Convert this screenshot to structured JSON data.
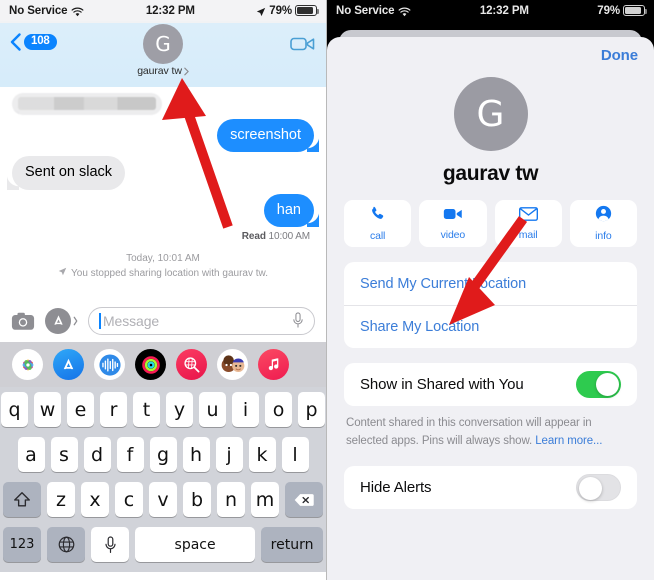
{
  "left_pane": {
    "status_bar": {
      "carrier": "No Service",
      "wifi_icon": "wifi-icon",
      "time": "12:32 PM",
      "location_icon": "location-arrow-icon",
      "battery": "79%"
    },
    "header": {
      "back_icon": "chevron-left-icon",
      "unread_badge": "108",
      "avatar_initial": "G",
      "contact_name": "gaurav tw",
      "disclosure_icon": "chevron-right-icon",
      "facetime_icon": "video-camera-icon"
    },
    "thread": {
      "messages": [
        {
          "side": "in",
          "text": "",
          "redacted": true
        },
        {
          "side": "out",
          "text": "screenshot",
          "redacted": false
        },
        {
          "side": "in",
          "text": "Sent on slack",
          "redacted": false
        },
        {
          "side": "out",
          "text": "han",
          "redacted": false
        }
      ],
      "receipt_label": "Read",
      "receipt_time": "10:00 AM",
      "system_timestamp": "Today, 10:01 AM",
      "system_icon": "location-arrow-icon",
      "system_text": "You stopped sharing location with gaurav tw."
    },
    "composer": {
      "camera_icon": "camera-icon",
      "appstore_icon": "app-store-icon",
      "appstore_chevron_icon": "chevron-right-icon",
      "placeholder": "Message",
      "value": "",
      "mic_icon": "microphone-icon"
    },
    "app_drawer": [
      {
        "name": "photos-app-icon",
        "label": "Photos"
      },
      {
        "name": "app-store-app-icon",
        "label": "App Store"
      },
      {
        "name": "audio-message-icon",
        "label": "Audio"
      },
      {
        "name": "fitness-app-icon",
        "label": "Fitness"
      },
      {
        "name": "images-search-icon",
        "label": "#images"
      },
      {
        "name": "memoji-app-icon",
        "label": "Memoji"
      },
      {
        "name": "apple-music-app-icon",
        "label": "Music"
      }
    ],
    "keyboard": {
      "row1": [
        "q",
        "w",
        "e",
        "r",
        "t",
        "y",
        "u",
        "i",
        "o",
        "p"
      ],
      "row2": [
        "a",
        "s",
        "d",
        "f",
        "g",
        "h",
        "j",
        "k",
        "l"
      ],
      "row3": [
        "z",
        "x",
        "c",
        "v",
        "b",
        "n",
        "m"
      ],
      "shift_icon": "shift-arrow-icon",
      "backspace_icon": "backspace-icon",
      "numbers_key": "123",
      "globe_icon": "globe-icon",
      "dictation_icon": "microphone-icon",
      "space_key": "space",
      "return_key": "return"
    }
  },
  "right_pane": {
    "status_bar": {
      "carrier": "No Service",
      "wifi_icon": "wifi-icon",
      "time": "12:32 PM",
      "battery": "79%"
    },
    "sheet": {
      "done_label": "Done",
      "avatar_initial": "G",
      "contact_name": "gaurav tw",
      "quick_actions": [
        {
          "icon": "phone-icon",
          "label": "call"
        },
        {
          "icon": "video-icon",
          "label": "video"
        },
        {
          "icon": "envelope-icon",
          "label": "mail"
        },
        {
          "icon": "person-icon",
          "label": "info"
        }
      ],
      "location_options": [
        "Send My Current Location",
        "Share My Location"
      ],
      "shared_with_you": {
        "label": "Show in Shared with You",
        "toggle_state": "on"
      },
      "footnote_text": "Content shared in this conversation will appear in selected apps. Pins will always show. ",
      "footnote_link": "Learn more...",
      "hide_alerts": {
        "label": "Hide Alerts",
        "toggle_state": "off"
      }
    }
  },
  "annotations": {
    "arrow_color": "#e01b1b",
    "arrows": [
      {
        "name": "arrow-to-contact-name"
      },
      {
        "name": "arrow-to-send-my-current-location"
      }
    ]
  }
}
